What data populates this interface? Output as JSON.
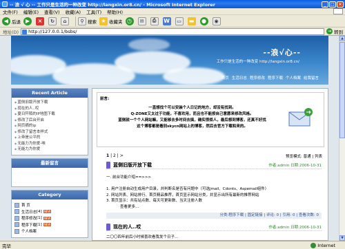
{
  "window": {
    "title": "-- 浪 √ 心 -- 工作只是生活的一种改变 http://langxin.or8.cn/ - Microsoft Internet Explorer",
    "controls": [
      "_",
      "□",
      "×"
    ]
  },
  "menu": [
    "文件(F)",
    "编辑(E)",
    "查看(V)",
    "收藏(A)",
    "工具(T)",
    "帮助(H)"
  ],
  "toolbar": {
    "back": "后退",
    "search": "搜索",
    "favorites": "收藏夹"
  },
  "address": {
    "label": "地址(D)",
    "url": "http://127.0.0.1/bsbs/",
    "go": "转到"
  },
  "banner": {
    "title": "--浪√心--",
    "subtitle": "工作只是生活的一种改变 http://langxin.or8.cn/",
    "nav": [
      "首页",
      "生活日志",
      "程序修改",
      "程序下载",
      "个人档案",
      "给我留言"
    ]
  },
  "sidebar": {
    "recent_title": "Recent Article",
    "recent_items": [
      "蓝侧旧版开放下载",
      "现在的人..哎",
      "夏日阡陌的IP地图下载",
      "修改了后台开启",
      "网页摘的ip",
      "修改了留言本样式",
      "上帝是公平的",
      "无能力为你爱-唉",
      "无能力为你爱"
    ],
    "guestbook_title": "最新留言",
    "category_title": "Category",
    "categories": [
      {
        "label": "首 页",
        "count": ""
      },
      {
        "label": "生活日志",
        "count": "[4]"
      },
      {
        "label": "程序修改",
        "count": "[1]"
      },
      {
        "label": "程序下载",
        "count": "[1]"
      },
      {
        "label": "个人档案",
        "count": ""
      }
    ],
    "new_badge": "NEW"
  },
  "notice": {
    "title": "前言:",
    "lines": [
      "一直想找个可以安装个人日记的地方，却没有找到。",
      "Q-ZONE又太过于功能，不喜欢用，而且也不能按自己意愿来修改风格。",
      "蓝侧就一个个人网站嘛，又能够去多时间去搞，确实很烦人，最后想到博客，还真不好找",
      "这个博客都是看别skycn网站上的博客，然后去官方下载和来的。"
    ]
  },
  "pager": {
    "pages": [
      "1",
      "2",
      ">"
    ],
    "view_label": "预览模式: 普通 | 列表"
  },
  "posts": [
    {
      "title": "蓝侧旧版开放下载",
      "meta": "作者:admin 日期:2006-10-31",
      "body": [
        "一. 前台功能介绍==>>>",
        "",
        "1. 用户注册自动生成用户目录，并判断名是否有问题中（可选jmail、Cdonts、Aspemail组件）",
        "2. 网站列表、网站排行、首页精品推荐，首页显示网站分类，并显示出所有最新的推荐网站",
        "3. 首页显示：共有站点数、每天可更新数、当天注册人数",
        "查看更多..."
      ],
      "footer": "分类:程序下载 | 固定链接 | 评论: 0 | 引用: 0 | 查看次数: 0"
    },
    {
      "title": "现在的人..哎",
      "meta": "作者:admin 日期:2006-10-31",
      "body": [
        "二〇〇四年前后小时候喜欢看我发个日子..."
      ],
      "footer": ""
    }
  ],
  "status": {
    "text": "完毕",
    "zone": "Internet"
  }
}
